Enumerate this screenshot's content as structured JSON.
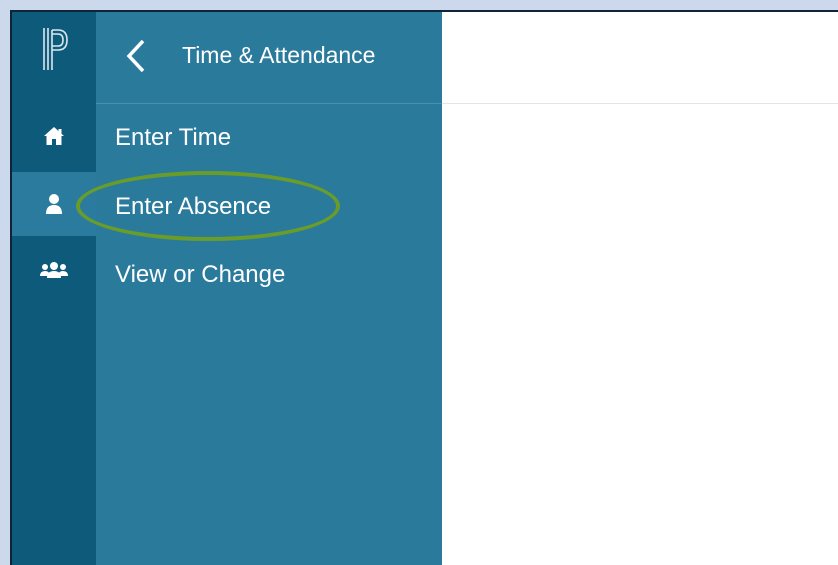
{
  "app": {
    "logo_icon": "powerschool-p-logo"
  },
  "rail": {
    "items": [
      {
        "icon": "home-icon",
        "active": false
      },
      {
        "icon": "person-icon",
        "active": true
      },
      {
        "icon": "group-icon",
        "active": false
      }
    ]
  },
  "panel": {
    "back_icon": "chevron-left-icon",
    "title": "Time & Attendance",
    "items": [
      {
        "label": "Enter Time"
      },
      {
        "label": "Enter Absence"
      },
      {
        "label": "View or Change"
      }
    ]
  },
  "colors": {
    "rail": "#0e5a7a",
    "panel": "#2a7a9c",
    "active_rail": "#2b7b9e",
    "highlight_ring": "#6a9c2a",
    "background": "#ccd8ec"
  }
}
